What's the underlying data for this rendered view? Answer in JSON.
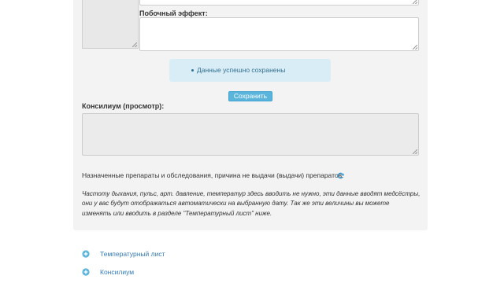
{
  "form": {
    "side_effect_label": "Побочный эффект:",
    "consilium_label": "Консилиум (просмотр):"
  },
  "alert": {
    "message": "Данные успешно сохранены"
  },
  "actions": {
    "save_label": "Сохранить"
  },
  "prescriptions": {
    "label": "Назначенные препараты и обследования, причина не выдачи (выдачи) препаратов:",
    "refresh_icon": "refresh-icon"
  },
  "note": {
    "text": "Частоту дыхания, пульс, арт. давление, температур здесь вводить не нужно, эти данные вводят медсёстры, они у вас будут отображаться автоматически на выбранную дату. Так же эти величины вы можете изменять или вводить в разделе \"Температурный лист\" ниже."
  },
  "links": [
    {
      "label": "Температурный лист",
      "icon": "plus-circle-icon"
    },
    {
      "label": "Консилиум",
      "icon": "plus-circle-icon"
    }
  ],
  "colors": {
    "accent": "#5bb4dc",
    "alert_bg": "#d9edf7",
    "alert_text": "#31708f",
    "link": "#337ab7"
  }
}
